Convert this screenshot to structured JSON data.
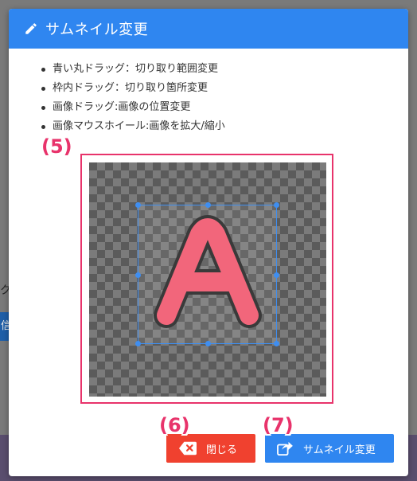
{
  "background": {
    "fragment_text": "ク",
    "fragment_button": "信"
  },
  "modal": {
    "title": "サムネイル変更",
    "header_icon": "pencil-icon",
    "instructions": [
      "青い丸ドラッグ：切り取り範囲変更",
      "枠内ドラッグ：切り取り箇所変更",
      "画像ドラッグ:画像の位置変更",
      "画像マウスホイール:画像を拡大/縮小"
    ],
    "image_letter": "A",
    "colors": {
      "header": "#2f86f0",
      "highlight": "#e8336b",
      "close_button": "#f0412f",
      "change_button": "#2f86f0",
      "letter_fill": "#f2667b",
      "letter_outline": "#3a3a3a"
    }
  },
  "callouts": {
    "crop": "(5)",
    "close": "(6)",
    "change": "(7)"
  },
  "buttons": {
    "close_label": "閉じる",
    "close_icon": "backspace-x-icon",
    "change_label": "サムネイル変更",
    "change_icon": "share-icon"
  }
}
